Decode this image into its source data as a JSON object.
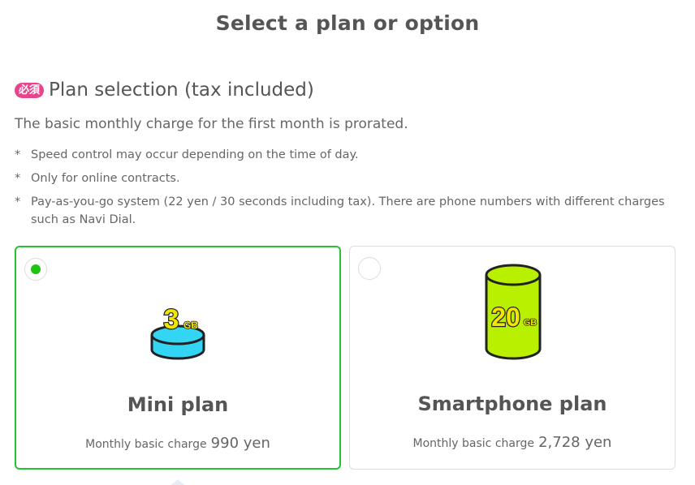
{
  "page": {
    "title": "Select a plan or option"
  },
  "section": {
    "badge": "必須",
    "heading": "Plan selection (tax included)",
    "intro": "The basic monthly charge for the first month is prorated.",
    "note_mark": "*",
    "notes": [
      "Speed control may occur depending on the time of day.",
      "Only for online contracts.",
      "Pay-as-you-go system (22 yen / 30 seconds including tax). There are phone numbers with different charges such as Navi Dial."
    ]
  },
  "plans": [
    {
      "name": "Mini plan",
      "price_label": "Monthly basic charge",
      "price_value": "990 yen",
      "selected": true,
      "icon": "data-3gb-icon",
      "icon_number": "3",
      "icon_unit": "GB"
    },
    {
      "name": "Smartphone plan",
      "price_label": "Monthly basic charge",
      "price_value": "2,728 yen",
      "selected": false,
      "icon": "data-20gb-icon",
      "icon_number": "20",
      "icon_unit": "GB"
    }
  ],
  "colors": {
    "selected_border": "#26c233",
    "radio_dot": "#1fc40f",
    "badge": "#e8448b",
    "mini_icon": "#33d5f5",
    "smart_icon": "#b8f000"
  }
}
